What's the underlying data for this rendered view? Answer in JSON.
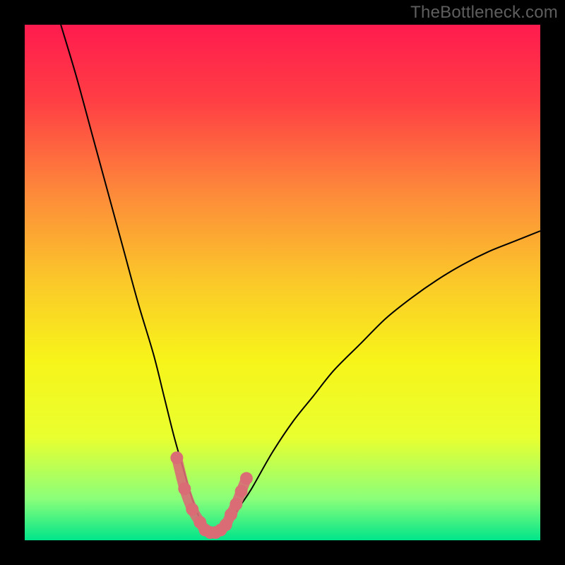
{
  "watermark": "TheBottleneck.com",
  "chart_data": {
    "type": "line",
    "title": "",
    "xlabel": "",
    "ylabel": "",
    "xlim": [
      0,
      100
    ],
    "ylim": [
      0,
      100
    ],
    "grid": false,
    "legend": false,
    "background_gradient": [
      {
        "stop": 0.0,
        "color": "#ff1b4e"
      },
      {
        "stop": 0.15,
        "color": "#ff3f44"
      },
      {
        "stop": 0.33,
        "color": "#fd8b3a"
      },
      {
        "stop": 0.5,
        "color": "#fbc929"
      },
      {
        "stop": 0.65,
        "color": "#f7f41a"
      },
      {
        "stop": 0.8,
        "color": "#e9ff2f"
      },
      {
        "stop": 0.92,
        "color": "#8aff7a"
      },
      {
        "stop": 1.0,
        "color": "#00e58a"
      }
    ],
    "series": [
      {
        "name": "curve",
        "stroke": "#000000",
        "x": [
          7,
          10,
          13,
          16,
          19,
          22,
          25,
          27,
          29,
          31,
          32.5,
          34,
          35,
          36.5,
          38,
          40,
          42,
          44,
          48,
          52,
          56,
          60,
          65,
          70,
          75,
          80,
          85,
          90,
          95,
          100
        ],
        "y": [
          100,
          90,
          79,
          68,
          57,
          46,
          36,
          28,
          20,
          13,
          8,
          4,
          2,
          1,
          2,
          4,
          7,
          10,
          17,
          23,
          28,
          33,
          38,
          43,
          47,
          50.5,
          53.5,
          56,
          58,
          60
        ]
      },
      {
        "name": "bottom-highlight",
        "stroke": "#d96c75",
        "x": [
          29.5,
          31,
          32.5,
          34,
          35,
          36,
          37,
          38,
          39,
          40,
          41,
          42,
          43
        ],
        "y": [
          16,
          10,
          6,
          3.5,
          2,
          1.5,
          1.5,
          2,
          3,
          5,
          7,
          9.5,
          12
        ]
      }
    ]
  }
}
